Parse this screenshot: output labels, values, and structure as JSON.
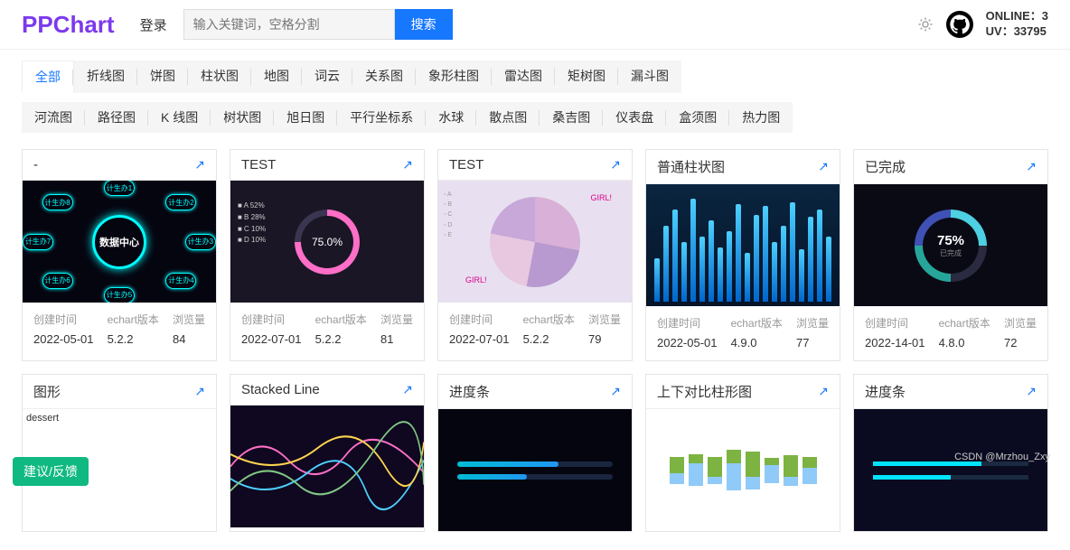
{
  "header": {
    "logo": "PPChart",
    "login": "登录",
    "search_placeholder": "输入关键词，空格分割",
    "search_btn": "搜索",
    "online_label": "ONLINE：",
    "online_val": "3",
    "uv_label": "UV：",
    "uv_val": "33795"
  },
  "tabs_row1": [
    "全部",
    "折线图",
    "饼图",
    "柱状图",
    "地图",
    "词云",
    "关系图",
    "象形柱图",
    "雷达图",
    "矩树图",
    "漏斗图"
  ],
  "tabs_row2": [
    "河流图",
    "路径图",
    "K 线图",
    "树状图",
    "旭日图",
    "平行坐标系",
    "水球",
    "散点图",
    "桑吉图",
    "仪表盘",
    "盒须图",
    "热力图"
  ],
  "active_tab": "全部",
  "meta_labels": {
    "created": "创建时间",
    "version": "echart版本",
    "views": "浏览量"
  },
  "cards": [
    {
      "title": "-",
      "created": "2022-05-01",
      "version": "5.2.2",
      "views": "84",
      "thumb": "t1"
    },
    {
      "title": "TEST",
      "created": "2022-07-01",
      "version": "5.2.2",
      "views": "81",
      "thumb": "t2"
    },
    {
      "title": "TEST",
      "created": "2022-07-01",
      "version": "5.2.2",
      "views": "79",
      "thumb": "t3"
    },
    {
      "title": "普通柱状图",
      "created": "2022-05-01",
      "version": "4.9.0",
      "views": "77",
      "thumb": "t4"
    },
    {
      "title": "已完成",
      "created": "2022-14-01",
      "version": "4.8.0",
      "views": "72",
      "thumb": "t5"
    },
    {
      "title": "图形",
      "created": "",
      "version": "",
      "views": "",
      "thumb": "t6"
    },
    {
      "title": "Stacked Line",
      "created": "",
      "version": "",
      "views": "",
      "thumb": "t7"
    },
    {
      "title": "进度条",
      "created": "",
      "version": "",
      "views": "",
      "thumb": "t8"
    },
    {
      "title": "上下对比柱形图",
      "created": "",
      "version": "",
      "views": "",
      "thumb": "t9"
    },
    {
      "title": "进度条",
      "created": "",
      "version": "",
      "views": "",
      "thumb": "t10"
    }
  ],
  "thumb_text": {
    "t1_center": "数据中心",
    "t1_nodes": [
      "计生办1",
      "计生办2",
      "计生办3",
      "计生办4",
      "计生办5",
      "计生办6",
      "计生办7",
      "计生办8"
    ],
    "t2_pct": "75.0%",
    "t2_legend": [
      "A 52%",
      "B 28%",
      "C 10%",
      "D 10%"
    ],
    "t3_legend": [
      "A",
      "B",
      "C",
      "D",
      "E"
    ],
    "t3_girl": "GIRL!",
    "t5_pct": "75%",
    "t5_sub": "已完成",
    "t6_text": "dessert"
  },
  "feedback": "建议/反馈",
  "watermark": "CSDN @Mrzhou_Zxy"
}
